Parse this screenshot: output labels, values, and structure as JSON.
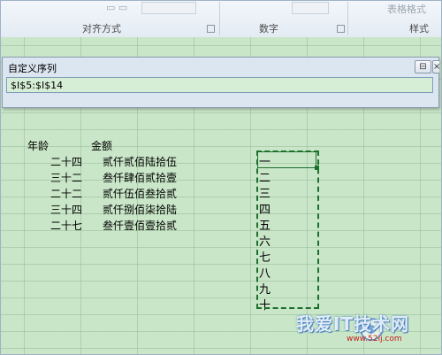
{
  "ribbon": {
    "groups": [
      {
        "label": "对齐方式"
      },
      {
        "label": "数字"
      },
      {
        "label": "样式"
      }
    ],
    "ghost_items": [
      "表格格式"
    ]
  },
  "dialog": {
    "title": "自定义序列",
    "ref_value": "$I$5:$I$14",
    "titlebar_icons": [
      "restore-icon",
      "close-icon"
    ]
  },
  "table": {
    "headers": {
      "age": "年龄",
      "amount": "金额"
    },
    "rows": [
      {
        "age": "二十四",
        "amount": "贰仟贰佰陆拾伍"
      },
      {
        "age": "三十二",
        "amount": "叁仟肆佰贰拾壹"
      },
      {
        "age": "二十二",
        "amount": "贰仟伍佰叁拾贰"
      },
      {
        "age": "三十四",
        "amount": "贰仟捌佰柒拾陆"
      },
      {
        "age": "二十七",
        "amount": "叁仟壹佰壹拾贰"
      }
    ]
  },
  "sequence": [
    "一",
    "二",
    "三",
    "四",
    "五",
    "六",
    "七",
    "八",
    "九",
    "十"
  ],
  "watermark": {
    "text": "我爱IT技术网",
    "url": "www.52ij.com"
  },
  "colors": {
    "sheet_bg": "#c9e6c8",
    "selection": "#1d6f2d",
    "dialog_bg": "#dce6f1"
  }
}
